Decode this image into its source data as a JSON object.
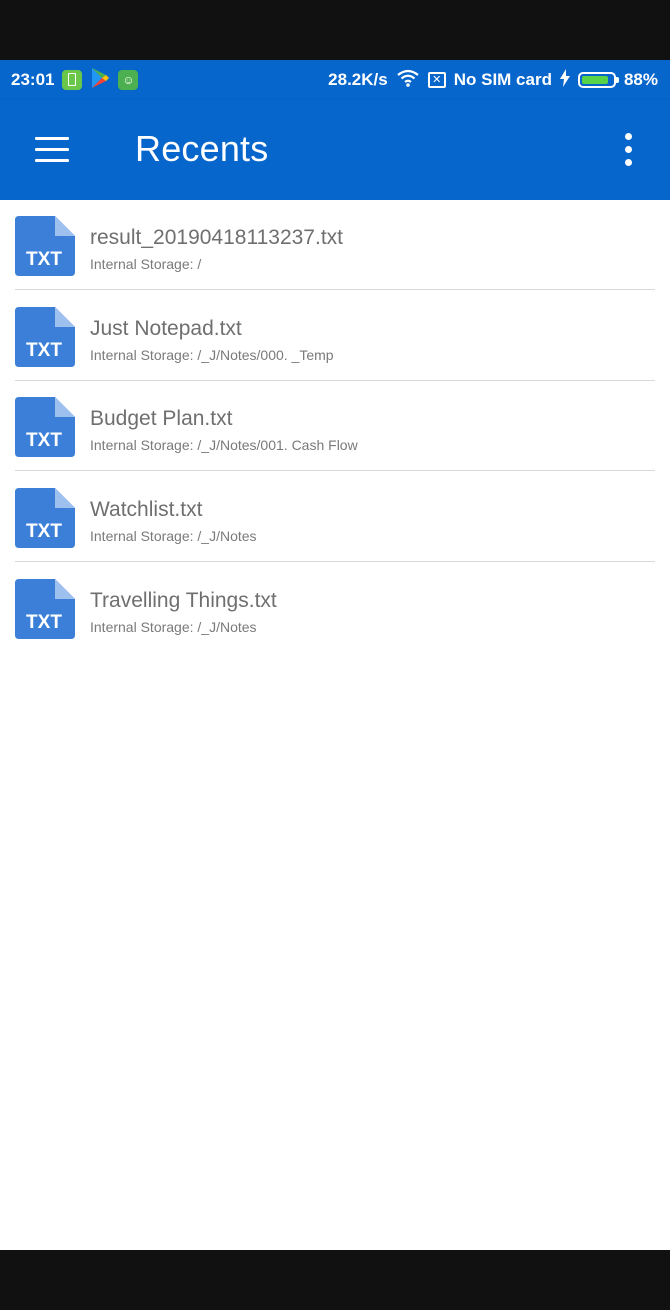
{
  "status_bar": {
    "time": "23:01",
    "speed": "28.2K/s",
    "carrier": "No SIM card",
    "battery": "88%",
    "battery_level": 0.88,
    "icons": [
      "battery-saver-icon",
      "play-store-icon",
      "app-cat-icon",
      "wifi-icon",
      "sim-x-icon",
      "charging-icon",
      "battery-icon"
    ]
  },
  "app_bar": {
    "title": "Recents",
    "menu_icon": "hamburger-menu-icon",
    "more_icon": "more-vert-icon",
    "color": "#0666cc"
  },
  "files": [
    {
      "name": "result_20190418113237.txt",
      "path": "Internal Storage: /",
      "icon_label": "TXT"
    },
    {
      "name": "Just Notepad.txt",
      "path": "Internal Storage: /_J/Notes/000. _Temp",
      "icon_label": "TXT"
    },
    {
      "name": "Budget Plan.txt",
      "path": "Internal Storage: /_J/Notes/001. Cash Flow",
      "icon_label": "TXT"
    },
    {
      "name": "Watchlist.txt",
      "path": "Internal Storage: /_J/Notes",
      "icon_label": "TXT"
    },
    {
      "name": "Travelling Things.txt",
      "path": "Internal Storage: /_J/Notes",
      "icon_label": "TXT"
    }
  ]
}
